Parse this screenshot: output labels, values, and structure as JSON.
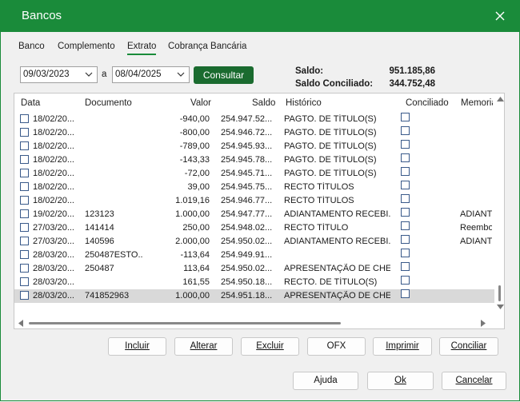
{
  "window": {
    "title": "Bancos"
  },
  "tabs": [
    "Banco",
    "Complemento",
    "Extrato",
    "Cobrança Bancária"
  ],
  "active_tab": 2,
  "filter": {
    "date_from": "09/03/2023",
    "separator": "a",
    "date_to": "08/04/2025",
    "consult_label": "Consultar"
  },
  "balances": {
    "saldo_label": "Saldo:",
    "saldo_value": "951.185,86",
    "conciliado_label": "Saldo Conciliado:",
    "conciliado_value": "344.752,48"
  },
  "table": {
    "columns": [
      "Data",
      "Documento",
      "Valor",
      "Saldo",
      "Histórico",
      "Conciliado",
      "Memorial"
    ],
    "rows": [
      {
        "data": "18/02/20...",
        "documento": "",
        "valor": "-940,00",
        "saldo": "254.947.52...",
        "historico": "PAGTO. DE TÍTULO(S)",
        "memorial": ""
      },
      {
        "data": "18/02/20...",
        "documento": "",
        "valor": "-800,00",
        "saldo": "254.946.72...",
        "historico": "PAGTO. DE TÍTULO(S)",
        "memorial": ""
      },
      {
        "data": "18/02/20...",
        "documento": "",
        "valor": "-789,00",
        "saldo": "254.945.93...",
        "historico": "PAGTO. DE TÍTULO(S)",
        "memorial": ""
      },
      {
        "data": "18/02/20...",
        "documento": "",
        "valor": "-143,33",
        "saldo": "254.945.78...",
        "historico": "PAGTO. DE TÍTULO(S)",
        "memorial": ""
      },
      {
        "data": "18/02/20...",
        "documento": "",
        "valor": "-72,00",
        "saldo": "254.945.71...",
        "historico": "PAGTO. DE TÍTULO(S)",
        "memorial": ""
      },
      {
        "data": "18/02/20...",
        "documento": "",
        "valor": "39,00",
        "saldo": "254.945.75...",
        "historico": "RECTO TÍTULOS",
        "memorial": ""
      },
      {
        "data": "18/02/20...",
        "documento": "",
        "valor": "1.019,16",
        "saldo": "254.946.77...",
        "historico": "RECTO TÍTULOS",
        "memorial": ""
      },
      {
        "data": "19/02/20...",
        "documento": "123123",
        "valor": "1.000,00",
        "saldo": "254.947.77...",
        "historico": "ADIANTAMENTO RECEBI...",
        "memorial": "ADIANT"
      },
      {
        "data": "27/03/20...",
        "documento": "141414",
        "valor": "250,00",
        "saldo": "254.948.02...",
        "historico": "RECTO TÍTULO",
        "memorial": "Reembo"
      },
      {
        "data": "27/03/20...",
        "documento": "140596",
        "valor": "2.000,00",
        "saldo": "254.950.02...",
        "historico": "ADIANTAMENTO RECEBI...",
        "memorial": "ADIANT"
      },
      {
        "data": "28/03/20...",
        "documento": "250487ESTO...",
        "valor": "-113,64",
        "saldo": "254.949.91...",
        "historico": "",
        "memorial": ""
      },
      {
        "data": "28/03/20...",
        "documento": "250487",
        "valor": "113,64",
        "saldo": "254.950.02...",
        "historico": "APRESENTAÇÃO DE CHE...",
        "memorial": ""
      },
      {
        "data": "28/03/20...",
        "documento": "",
        "valor": "161,55",
        "saldo": "254.950.18...",
        "historico": "RECTO. DE TÍTULO(S)",
        "memorial": ""
      },
      {
        "data": "28/03/20...",
        "documento": "741852963",
        "valor": "1.000,00",
        "saldo": "254.951.18...",
        "historico": "APRESENTAÇÃO DE CHE...",
        "memorial": ""
      }
    ],
    "selected_row": 13
  },
  "actions": [
    "Incluir",
    "Alterar",
    "Excluir",
    "OFX",
    "Imprimir",
    "Conciliar"
  ],
  "footer": [
    "Ajuda",
    "Ok",
    "Cancelar"
  ],
  "colors": {
    "brand": "#1a8b3a",
    "consult_button": "#1a6b2f"
  }
}
